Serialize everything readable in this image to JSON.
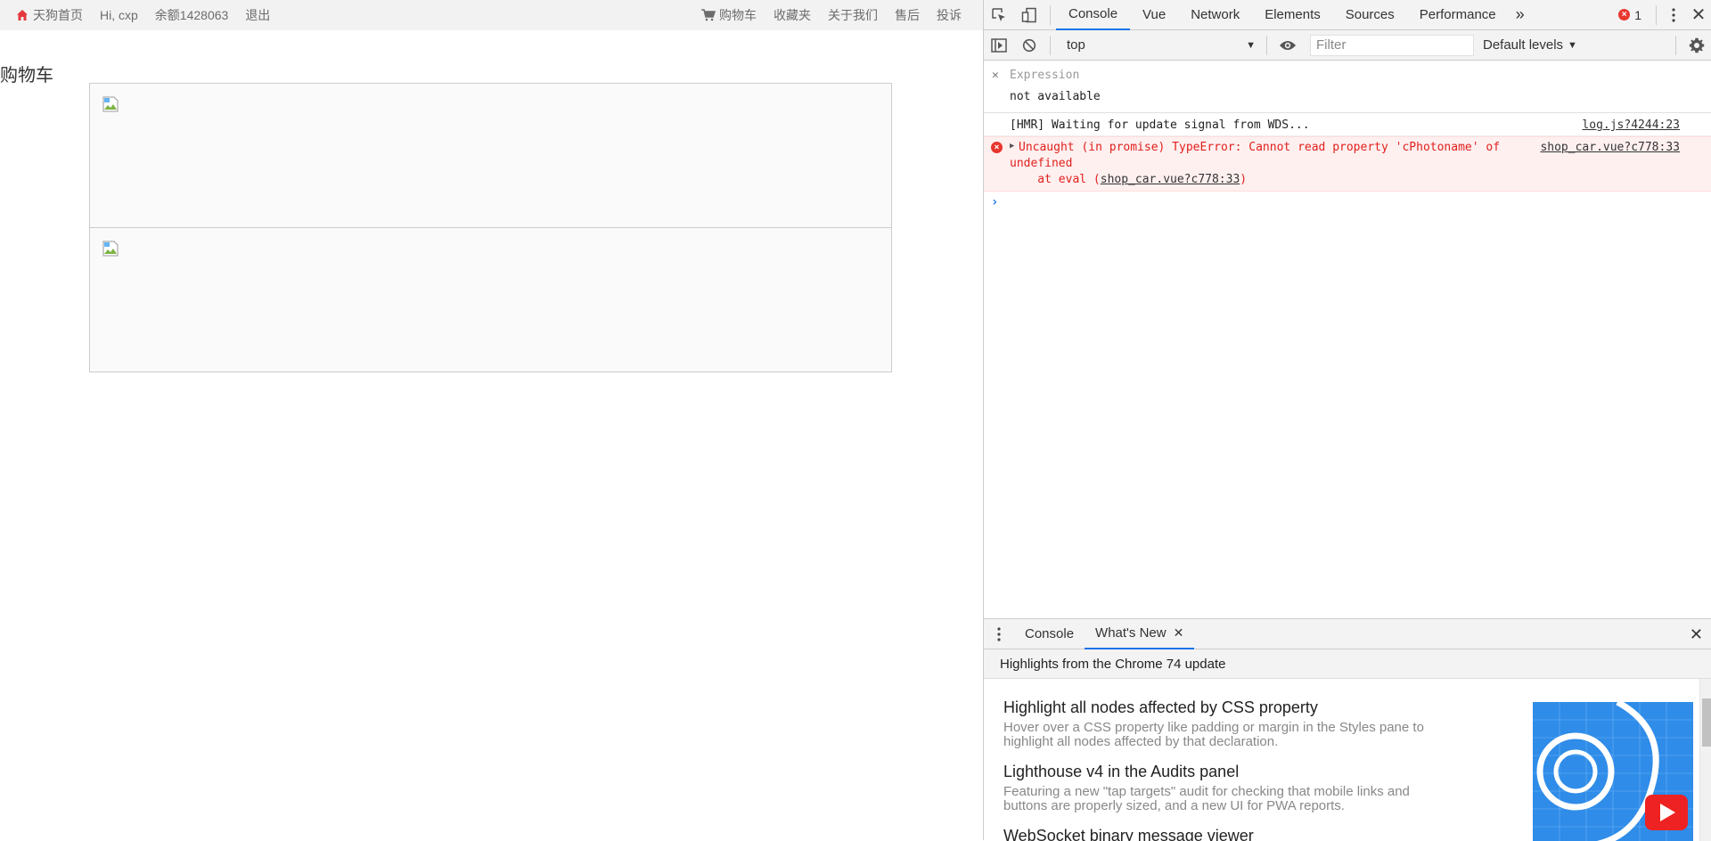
{
  "site_nav": {
    "home": "天狗首页",
    "greeting": "Hi, cxp",
    "balance": "余额1428063",
    "logout": "退出",
    "cart": "购物车",
    "favorites": "收藏夹",
    "about": "关于我们",
    "after_sales": "售后",
    "complaint": "投诉"
  },
  "page": {
    "title": "购物车",
    "cart_items": [
      {
        "image": "broken-image-icon"
      },
      {
        "image": "broken-image-icon"
      }
    ]
  },
  "devtools": {
    "tabs": [
      "Console",
      "Vue",
      "Network",
      "Elements",
      "Sources",
      "Performance"
    ],
    "active_tab": "Console",
    "more_tabs": "»",
    "error_count": "1",
    "toolbar": {
      "context": "top",
      "filter_placeholder": "Filter",
      "levels": "Default levels"
    },
    "expression": {
      "label": "Expression",
      "value": "not available"
    },
    "log": {
      "message": "[HMR] Waiting for update signal from WDS...",
      "source": "log.js?4244:23"
    },
    "error": {
      "line1": "Uncaught (in promise) TypeError: Cannot read property 'cPhotoname' of",
      "source": "shop_car.vue?c778:33",
      "line2": "undefined",
      "line3_prefix": "    at eval (",
      "line3_source": "shop_car.vue?c778:33",
      "line3_suffix": ")"
    },
    "drawer": {
      "tabs": [
        "Console",
        "What's New"
      ],
      "active_tab": "What's New",
      "header": "Highlights from the Chrome 74 update",
      "items": [
        {
          "title": "Highlight all nodes affected by CSS property",
          "desc1": "Hover over a CSS property like padding or margin in the Styles pane to",
          "desc2": "highlight all nodes affected by that declaration."
        },
        {
          "title": "Lighthouse v4 in the Audits panel",
          "desc1": "Featuring a new \"tap targets\" audit for checking that mobile links and",
          "desc2": "buttons are properly sized, and a new UI for PWA reports."
        },
        {
          "title": "WebSocket binary message viewer",
          "desc1": "",
          "desc2": ""
        }
      ]
    }
  },
  "colors": {
    "accent": "#1a73e8",
    "error": "#e0201c",
    "home_icon": "#e4393c"
  }
}
